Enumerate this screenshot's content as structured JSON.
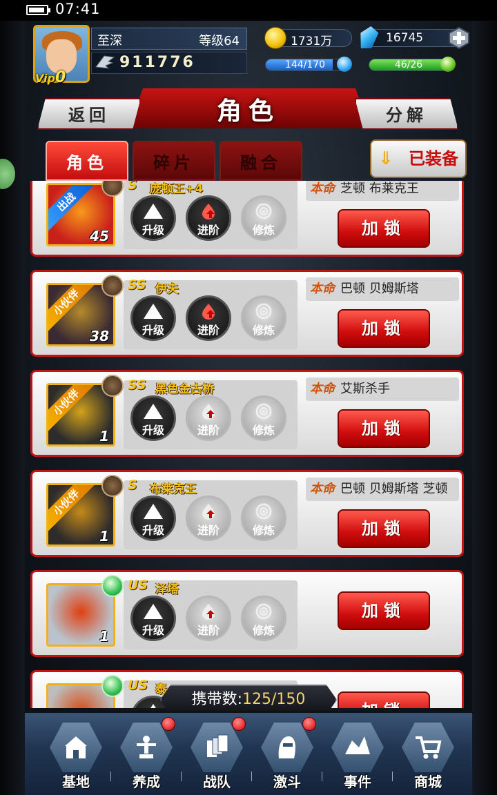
{
  "status": {
    "time": "07:41"
  },
  "player": {
    "name": "至深",
    "level_label": "等级64",
    "vip_prefix": "Vip",
    "vip_level": "0",
    "power": "911776",
    "gold": "1731万",
    "gems": "16745",
    "stamina_text": "144/170",
    "stamina_fraction": 0.85,
    "energy_text": "46/26",
    "energy_fraction": 1.0
  },
  "header": {
    "title": "角色",
    "back_label": "返回",
    "decompose_label": "分解"
  },
  "tabs": [
    {
      "label": "角色",
      "active": true
    },
    {
      "label": "碎片",
      "active": false
    },
    {
      "label": "融合",
      "active": false
    }
  ],
  "equipped_label": "已装备",
  "action_labels": {
    "upgrade": "升级",
    "advance": "进阶",
    "train": "修炼"
  },
  "fate_tag": "本命",
  "lock_label": "加锁",
  "ribbon_labels": {
    "battle": "出战",
    "partner": "小伙伴"
  },
  "heroes": [
    {
      "rank": "S",
      "name": "庞顿王+4",
      "level": "45",
      "ribbon": "battle",
      "fate": "芝顿 布莱克王",
      "upgrade_on": true,
      "advance_on": true,
      "train_on": false,
      "badge": "claw",
      "palette": [
        "#c9201b",
        "#f79a1b"
      ]
    },
    {
      "rank": "SS",
      "name": "伊夫",
      "level": "38",
      "ribbon": "partner",
      "fate": "巴顿 贝姆斯塔",
      "upgrade_on": true,
      "advance_on": true,
      "train_on": false,
      "badge": "claw",
      "palette": [
        "#3a2a33",
        "#b48a2a"
      ]
    },
    {
      "rank": "SS",
      "name": "黑色金古桥",
      "level": "1",
      "ribbon": "partner",
      "fate": "艾斯杀手",
      "upgrade_on": true,
      "advance_on": false,
      "train_on": false,
      "badge": "claw",
      "palette": [
        "#2c2c2c",
        "#d3a21b"
      ]
    },
    {
      "rank": "S",
      "name": "布莱克王",
      "level": "1",
      "ribbon": "partner",
      "fate": "巴顿 贝姆斯塔 芝顿",
      "upgrade_on": true,
      "advance_on": false,
      "train_on": false,
      "badge": "claw",
      "palette": [
        "#2e2b2b",
        "#c48a1a"
      ]
    },
    {
      "rank": "US",
      "name": "泽塔",
      "level": "1",
      "ribbon": "",
      "fate": "",
      "upgrade_on": true,
      "advance_on": false,
      "train_on": false,
      "badge": "orb",
      "palette": [
        "#b9c3cc",
        "#e04012"
      ]
    },
    {
      "rank": "US",
      "name": "泰",
      "level": "",
      "ribbon": "",
      "fate": "",
      "upgrade_on": true,
      "advance_on": false,
      "train_on": false,
      "badge": "orb",
      "palette": [
        "#bdbdbd",
        "#d84a12"
      ]
    }
  ],
  "carry": {
    "label": "携带数:",
    "value": "125/150"
  },
  "bottom_nav": [
    {
      "label": "基地",
      "icon": "base-icon",
      "badge": false
    },
    {
      "label": "养成",
      "icon": "training-icon",
      "badge": true
    },
    {
      "label": "战队",
      "icon": "team-icon",
      "badge": true
    },
    {
      "label": "激斗",
      "icon": "battle-icon",
      "badge": true
    },
    {
      "label": "事件",
      "icon": "event-icon",
      "badge": false
    },
    {
      "label": "商城",
      "icon": "shop-cart-icon",
      "badge": false
    }
  ],
  "colors": {
    "accent_red": "#c81414",
    "gold": "#f7c21a",
    "stamina": "#2d7be0",
    "energy": "#2fb82f"
  }
}
